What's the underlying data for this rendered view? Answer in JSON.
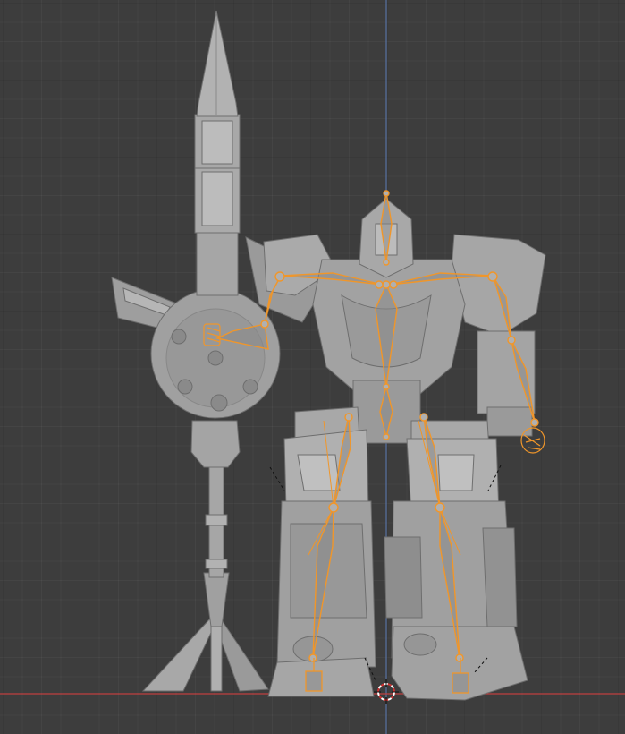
{
  "viewport": {
    "colors": {
      "background": "#3d3d3d",
      "x_axis": "#c04040",
      "z_axis": "#5a7ab5",
      "armature": "#f0962a",
      "mesh": "#9c9c9c",
      "mesh_light": "#b4b4b4",
      "mesh_dark": "#7a7a7a"
    },
    "objects": {
      "model": "robot-mesh",
      "weapon": "staff-mesh",
      "rig": "armature",
      "cursor": "3d-cursor-icon"
    }
  }
}
